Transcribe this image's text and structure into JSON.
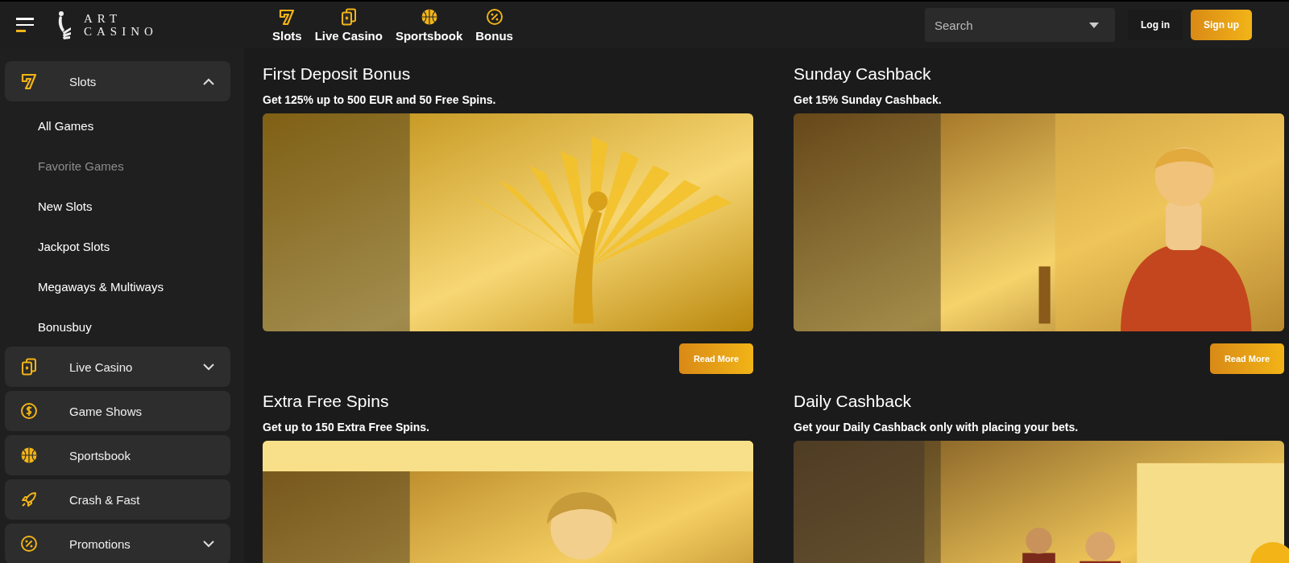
{
  "header": {
    "logo": [
      "ART",
      "CASINO"
    ],
    "nav": [
      {
        "label": "Slots",
        "selected": false
      },
      {
        "label": "Live Casino",
        "selected": false
      },
      {
        "label": "Sportsbook",
        "selected": false
      },
      {
        "label": "Bonus",
        "selected": false
      }
    ],
    "search": {
      "placeholder": "Search"
    },
    "buttons": [
      {
        "label": "Log in",
        "kind": "plain"
      },
      {
        "label": "Sign up",
        "kind": "primary"
      }
    ]
  },
  "sidebar": {
    "items": [
      {
        "label": "Slots",
        "expanded": true,
        "children": [
          {
            "label": "All Games",
            "disabled": false
          },
          {
            "label": "Favorite Games",
            "disabled": true
          },
          {
            "label": "New Slots",
            "disabled": false
          },
          {
            "label": "Jackpot Slots",
            "disabled": false
          },
          {
            "label": "Megaways & Multiways",
            "disabled": false
          },
          {
            "label": "Bonusbuy",
            "disabled": false
          }
        ]
      },
      {
        "label": "Live Casino",
        "expanded": false
      },
      {
        "label": "Game Shows"
      },
      {
        "label": "Sportsbook"
      },
      {
        "label": "Crash & Fast"
      },
      {
        "label": "Promotions",
        "expanded": false
      }
    ]
  },
  "promotions": [
    {
      "title": "First Deposit Bonus",
      "subtitle": "Get 125% up to 500 EUR and 50 Free Spins.",
      "button": "Read More"
    },
    {
      "title": "Sunday Cashback",
      "subtitle": "Get 15% Sunday Cashback.",
      "button": "Read More"
    },
    {
      "title": "Extra Free Spins",
      "subtitle": "Get up to 150 Extra Free Spins."
    },
    {
      "title": "Daily Cashback",
      "subtitle": "Get your Daily Cashback only with placing your bets."
    }
  ]
}
